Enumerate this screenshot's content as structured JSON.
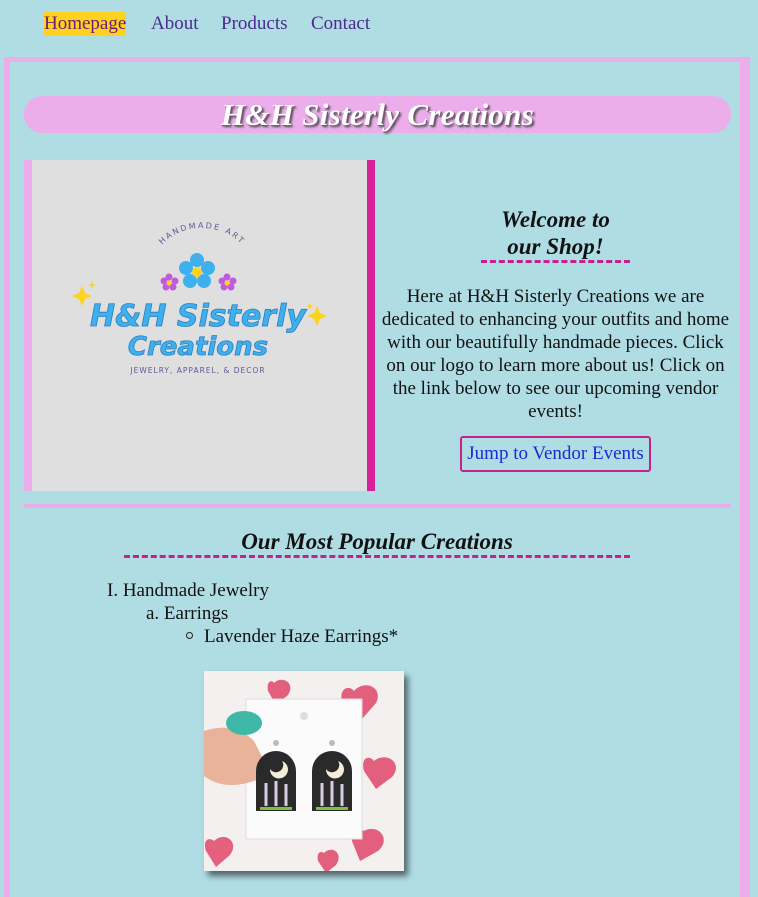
{
  "nav": {
    "items": [
      "Homepage",
      "About",
      "Products",
      "Contact"
    ],
    "active": "Homepage"
  },
  "banner": {
    "title": "H&H Sisterly Creations"
  },
  "logo": {
    "top_text": "HANDMADE ART",
    "line1": "H&H Sisterly",
    "line2": "Creations",
    "tagline": "JEWELRY, APPAREL, & DECOR"
  },
  "welcome": {
    "title_line1": "Welcome to",
    "title_line2": "our Shop!",
    "body": "Here at H&H Sisterly Creations we are dedicated to enhancing your outfits and home with our beautifully handmade pieces. Click on our logo to learn more about us! Click on the link below to see our upcoming vendor events!",
    "button_label": "Jump to Vendor Events"
  },
  "popular": {
    "title": "Our Most Popular Creations",
    "level1": "I. Handmade Jewelry",
    "level2": "a. Earrings",
    "level3": "Lavender Haze Earrings*"
  },
  "colors": {
    "background": "#b0dde4",
    "pink": "#ecaeea",
    "magenta": "#d9219a",
    "highlight": "#ffd21f",
    "nav_link": "#4b2a8e",
    "button_text": "#1a2ad8"
  }
}
